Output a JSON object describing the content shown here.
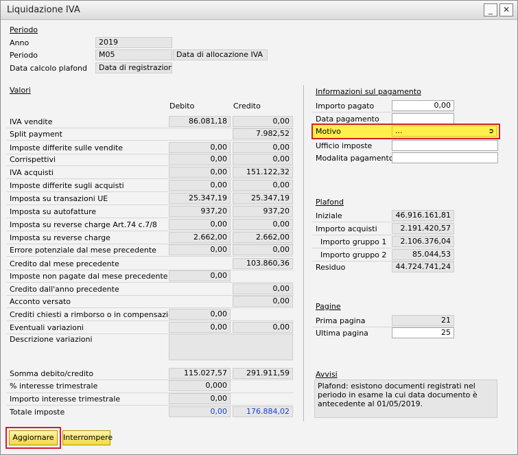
{
  "window": {
    "title": "Liquidazione IVA",
    "min_glyph": "_",
    "close_glyph": "✕"
  },
  "periodo": {
    "header": "Periodo",
    "anno_label": "Anno",
    "anno_value": "2019",
    "periodo_label": "Periodo",
    "periodo_value": "M05",
    "periodo_desc": "Data di allocazione IVA",
    "plafond_label": "Data calcolo plafond",
    "plafond_value": "Data di registrazione"
  },
  "valori": {
    "header": "Valori",
    "col_debito": "Debito",
    "col_credito": "Credito",
    "rows": [
      {
        "label": "IVA vendite",
        "debito": "86.081,18",
        "credito": "0,00"
      },
      {
        "label": "Split payment",
        "debito": null,
        "credito": "7.982,52"
      },
      {
        "label": "Imposte differite sulle vendite",
        "debito": "0,00",
        "credito": "0,00"
      },
      {
        "label": "Corrispettivi",
        "debito": "0,00",
        "credito": "0,00"
      },
      {
        "label": "IVA acquisti",
        "debito": "0,00",
        "credito": "151.122,32"
      },
      {
        "label": "Imposte differite sugli acquisti",
        "debito": "0,00",
        "credito": "0,00"
      },
      {
        "label": "Imposta su transazioni UE",
        "debito": "25.347,19",
        "credito": "25.347,19"
      },
      {
        "label": "Imposta su autofatture",
        "debito": "937,20",
        "credito": "937,20"
      },
      {
        "label": "Imposta su reverse charge Art.74 c.7/8",
        "debito": "0,00",
        "credito": "0,00"
      },
      {
        "label": "Imposta su reverse charge",
        "debito": "2.662,00",
        "credito": "2.662,00"
      },
      {
        "label": "Errore potenziale dal mese precedente",
        "debito": "0,00",
        "credito": "0,00"
      },
      {
        "label": "Credito dal mese precedente",
        "debito": null,
        "credito": "103.860,36"
      },
      {
        "label": "Imposte non pagate dal mese precedente",
        "debito": "0,00",
        "credito": null
      },
      {
        "label": "Credito dall'anno precedente",
        "debito": null,
        "credito": "0,00"
      },
      {
        "label": "Acconto versato",
        "debito": null,
        "credito": "0,00"
      },
      {
        "label": "Crediti chiesti a rimborso o in compensazione",
        "debito": "0,00",
        "credito": null
      },
      {
        "label": "Eventuali variazioni",
        "debito": "0,00",
        "credito": "0,00"
      }
    ],
    "descrizione_label": "Descrizione variazioni",
    "somma_label": "Somma debito/credito",
    "somma_debito": "115.027,57",
    "somma_credito": "291.911,59",
    "interesse_label": "% interesse trimestrale",
    "interesse_value": "0,000",
    "importo_interesse_label": "Importo interesse trimestrale",
    "importo_interesse_value": "0,00",
    "totale_label": "Totale imposte",
    "totale_debito": "0,00",
    "totale_credito": "176.884,02"
  },
  "pagamento": {
    "header": "Informazioni sul pagamento",
    "importo_label": "Importo pagato",
    "importo_value": "0,00",
    "data_label": "Data pagamento",
    "data_value": "",
    "motivo_label": "Motivo",
    "motivo_value": "...",
    "ufficio_label": "Ufficio imposte",
    "ufficio_value": "",
    "modalita_label": "Modalita pagamento",
    "modalita_value": ""
  },
  "plafond": {
    "header": "Plafond",
    "iniziale_label": "Iniziale",
    "iniziale_value": "46.916.161,81",
    "acquisti_label": "Importo acquisti",
    "acquisti_value": "2.191.420,57",
    "gruppo1_label": "Importo gruppo 1",
    "gruppo1_value": "2.106.376,04",
    "gruppo2_label": "Importo gruppo 2",
    "gruppo2_value": "85.044,53",
    "residuo_label": "Residuo",
    "residuo_value": "44.724.741,24"
  },
  "pagine": {
    "header": "Pagine",
    "prima_label": "Prima pagina",
    "prima_value": "21",
    "ultima_label": "Ultima pagina",
    "ultima_value": "25"
  },
  "avvisi": {
    "header": "Avvisi",
    "text": "Plafond: esistono documenti registrati nel periodo in esame la cui data documento è antecedente al 01/05/2019."
  },
  "buttons": {
    "aggiornare": "Aggiornare",
    "interrompere": "Interrompere"
  },
  "colors": {
    "highlight": "#d01f2b",
    "yellow": "#fff04a",
    "link_value": "#1a3fd0",
    "button": "#f1d94a"
  }
}
